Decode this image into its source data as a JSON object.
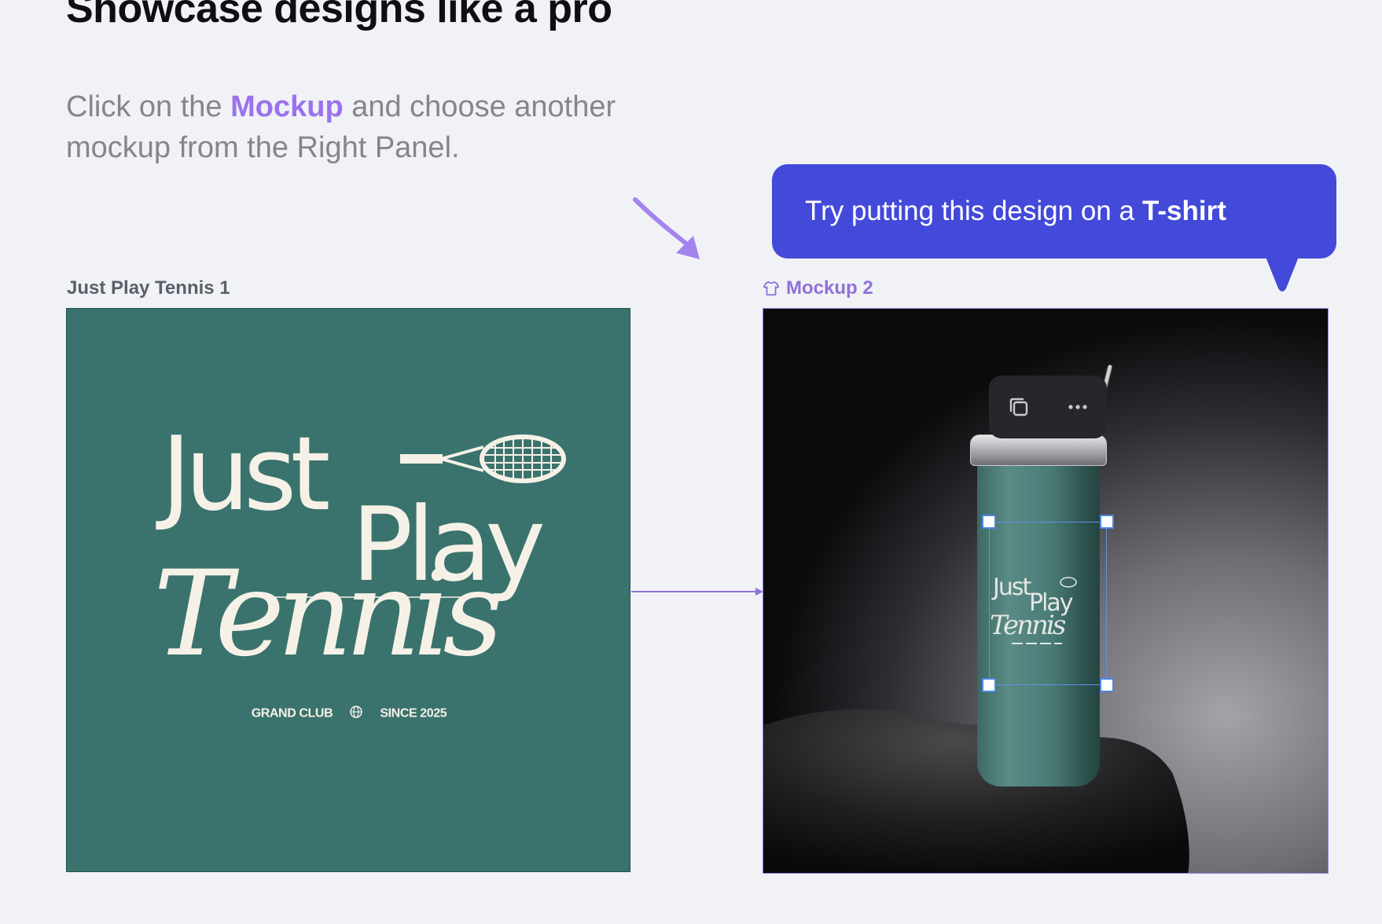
{
  "page": {
    "title": "Showcase designs like a pro",
    "instructions": {
      "part1": "Click on the ",
      "highlight": "Mockup",
      "part2": " and choose another mockup from the Right Panel."
    }
  },
  "bubble": {
    "text": "Try putting this design on a",
    "bold": "T-shirt"
  },
  "frames": {
    "design": {
      "label": "Just Play Tennis 1",
      "logo": {
        "word1": "Just",
        "word2": "Play",
        "word3": "Tennis",
        "left_text": "GRAND CLUB",
        "right_text": "SINCE 2025"
      }
    },
    "mockup": {
      "label": "Mockup 2",
      "icon": "tshirt-icon"
    }
  },
  "toolbar": {
    "buttons": [
      "duplicate-icon",
      "more-icon"
    ]
  },
  "colors": {
    "background": "#f1f2f6",
    "accent": "#9b72ee",
    "bubble": "#4349d9",
    "design_bg": "#3a736d",
    "logo": "#f6f1e7",
    "selection": "#5d93e6"
  }
}
